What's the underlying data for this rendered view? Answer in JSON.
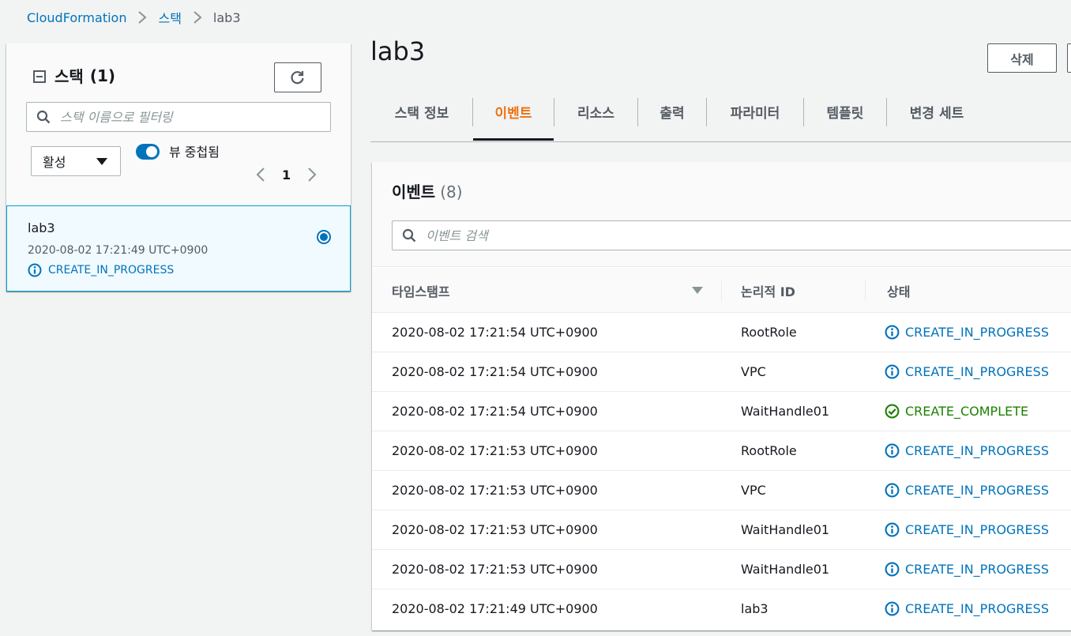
{
  "breadcrumb": {
    "items": [
      {
        "label": "CloudFormation"
      },
      {
        "label": "스택"
      }
    ],
    "current": "lab3"
  },
  "stacks_panel": {
    "title": "스택",
    "count": "(1)",
    "search_placeholder": "스택 이름으로 필터링",
    "filter_select": "활성",
    "toggle_label": "뷰 중첩됨",
    "toggle_on": true,
    "page": "1",
    "selected_stack": {
      "name": "lab3",
      "date": "2020-08-02 17:21:49 UTC+0900",
      "status": "CREATE_IN_PROGRESS"
    }
  },
  "page": {
    "title": "lab3",
    "delete_label": "삭제"
  },
  "tabs": [
    {
      "label": "스택 정보",
      "active": false
    },
    {
      "label": "이벤트",
      "active": true
    },
    {
      "label": "리소스",
      "active": false
    },
    {
      "label": "출력",
      "active": false
    },
    {
      "label": "파라미터",
      "active": false
    },
    {
      "label": "템플릿",
      "active": false
    },
    {
      "label": "변경 세트",
      "active": false
    }
  ],
  "events": {
    "title": "이벤트",
    "count": "(8)",
    "search_placeholder": "이벤트 검색",
    "columns": {
      "timestamp": "타임스탬프",
      "logical_id": "논리적 ID",
      "status": "상태"
    },
    "rows": [
      {
        "timestamp": "2020-08-02 17:21:54 UTC+0900",
        "logical_id": "RootRole",
        "status": "CREATE_IN_PROGRESS",
        "status_type": "info"
      },
      {
        "timestamp": "2020-08-02 17:21:54 UTC+0900",
        "logical_id": "VPC",
        "status": "CREATE_IN_PROGRESS",
        "status_type": "info"
      },
      {
        "timestamp": "2020-08-02 17:21:54 UTC+0900",
        "logical_id": "WaitHandle01",
        "status": "CREATE_COMPLETE",
        "status_type": "success"
      },
      {
        "timestamp": "2020-08-02 17:21:53 UTC+0900",
        "logical_id": "RootRole",
        "status": "CREATE_IN_PROGRESS",
        "status_type": "info"
      },
      {
        "timestamp": "2020-08-02 17:21:53 UTC+0900",
        "logical_id": "VPC",
        "status": "CREATE_IN_PROGRESS",
        "status_type": "info"
      },
      {
        "timestamp": "2020-08-02 17:21:53 UTC+0900",
        "logical_id": "WaitHandle01",
        "status": "CREATE_IN_PROGRESS",
        "status_type": "info"
      },
      {
        "timestamp": "2020-08-02 17:21:53 UTC+0900",
        "logical_id": "WaitHandle01",
        "status": "CREATE_IN_PROGRESS",
        "status_type": "info"
      },
      {
        "timestamp": "2020-08-02 17:21:49 UTC+0900",
        "logical_id": "lab3",
        "status": "CREATE_IN_PROGRESS",
        "status_type": "info"
      }
    ]
  },
  "colors": {
    "link": "#0073bb",
    "active_tab": "#ec7211",
    "success": "#1d8102",
    "selected_bg": "#f1faff"
  }
}
